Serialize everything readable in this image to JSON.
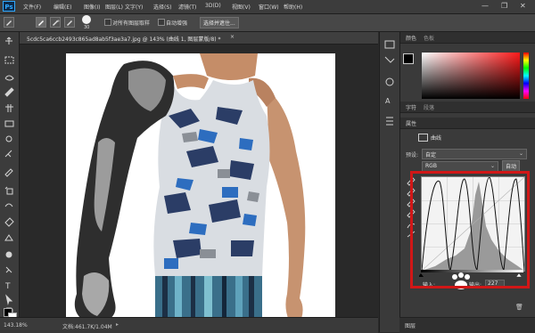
{
  "menubar": {
    "logo": "Ps",
    "items": [
      "文件(F)",
      "编辑(E)",
      "图像(I)",
      "图层(L)",
      "文字(Y)",
      "选择(S)",
      "滤镜(T)",
      "3D(D)",
      "视图(V)",
      "窗口(W)",
      "帮助(H)"
    ],
    "window_controls": [
      "—",
      "❐",
      "✕"
    ]
  },
  "options_bar": {
    "brush_size": "30",
    "sample_all_layers_label": "对所有图层取样",
    "auto_enhance_label": "自动增强",
    "select_subject_label": "选择并遮住..."
  },
  "document": {
    "tab_title": "5cdc5ca6ccb2493c865ad8ab5f3ae3a7.jpg @ 143% (曲线 1, 图层蒙版/8) *",
    "close": "×"
  },
  "status": {
    "zoom": "143.18%",
    "doc_info": "文档:461.7K/1.04M"
  },
  "color_panel": {
    "tabs": [
      "颜色",
      "色板"
    ],
    "fg_color": "#000000",
    "bg_color": "#ffffff",
    "hue_color": "#ff1a1a"
  },
  "char_panel": {
    "tabs": [
      "字符",
      "段落"
    ]
  },
  "properties": {
    "tab": "属性",
    "title": "曲线",
    "preset_label": "预设:",
    "preset_value": "自定",
    "channel_value": "RGB",
    "auto_button": "自动",
    "input_label": "输入:",
    "output_label": "输出:",
    "output_value": "227"
  },
  "bottom_panel": {
    "label": "图层"
  }
}
